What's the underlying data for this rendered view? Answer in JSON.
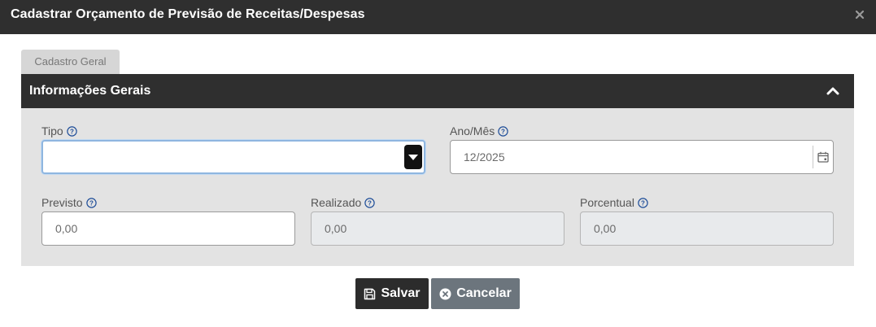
{
  "modal": {
    "title": "Cadastrar Orçamento de Previsão de Receitas/Despesas",
    "close_icon": "close-icon"
  },
  "tabs": [
    {
      "label": "Cadastro Geral"
    }
  ],
  "section": {
    "title": "Informações Gerais",
    "toggle_icon": "chevron-up-icon"
  },
  "fields": {
    "tipo": {
      "label": "Tipo",
      "value": ""
    },
    "ano_mes": {
      "label": "Ano/Mês",
      "value": "12/2025"
    },
    "previsto": {
      "label": "Previsto",
      "value": "0,00"
    },
    "realizado": {
      "label": "Realizado",
      "value": "0,00"
    },
    "porcentual": {
      "label": "Porcentual",
      "value": "0,00"
    }
  },
  "buttons": {
    "save_label": "Salvar",
    "cancel_label": "Cancelar"
  },
  "colors": {
    "header": "#2f2f2f",
    "section_bg": "#e3e3e3",
    "cancel": "#6c757d",
    "help_icon": "#1f4e99"
  }
}
